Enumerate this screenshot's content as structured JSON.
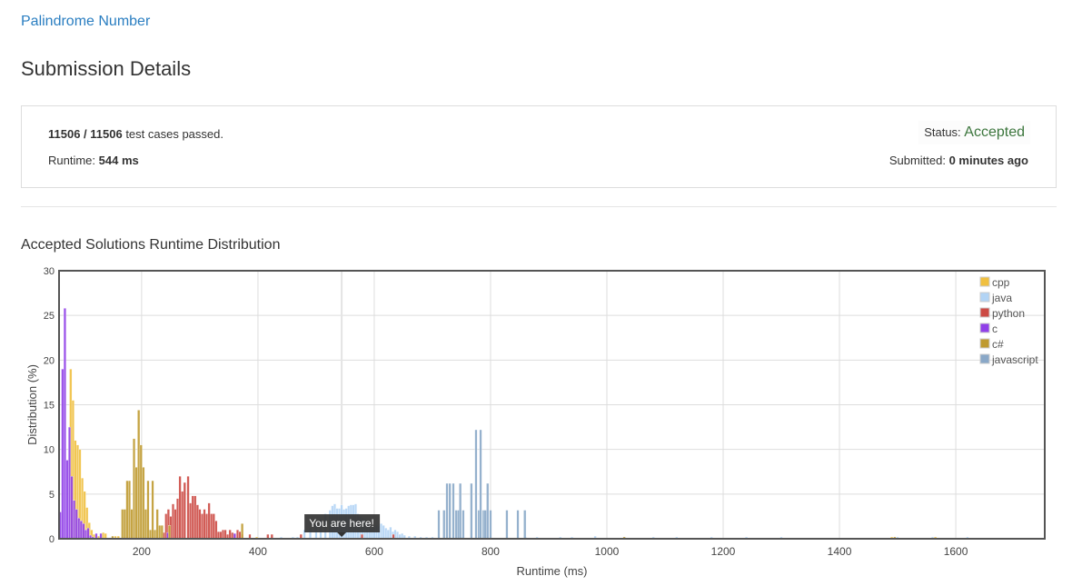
{
  "header": {
    "problem_link": "Palindrome Number",
    "page_title": "Submission Details"
  },
  "result": {
    "passed": "11506 / 11506",
    "passed_suffix": " test cases passed.",
    "runtime_label": "Runtime: ",
    "runtime_value": "544 ms",
    "status_label": "Status: ",
    "status_value": "Accepted",
    "submitted_label": "Submitted: ",
    "submitted_value": "0 minutes ago"
  },
  "chart_title": "Accepted Solutions Runtime Distribution",
  "chart_data": {
    "type": "bar",
    "xlabel": "Runtime (ms)",
    "ylabel": "Distribution (%)",
    "xlim": [
      58,
      1753
    ],
    "ylim": [
      0,
      30
    ],
    "xticks": [
      200,
      400,
      600,
      800,
      1000,
      1200,
      1400,
      1600
    ],
    "yticks": [
      0,
      5,
      10,
      15,
      20,
      25,
      30
    ],
    "grid": true,
    "legend_position": "top-right",
    "annotation": {
      "text": "You are here!",
      "x": 544
    },
    "series": [
      {
        "name": "cpp",
        "color": "#f0c040",
        "points": [
          [
            78,
            19
          ],
          [
            82,
            15.5
          ],
          [
            86,
            11
          ],
          [
            90,
            10.5
          ],
          [
            94,
            10
          ],
          [
            98,
            6.8
          ],
          [
            102,
            5.3
          ],
          [
            106,
            3.5
          ],
          [
            110,
            1.8
          ],
          [
            114,
            1
          ],
          [
            118,
            0.5
          ],
          [
            126,
            0.3
          ],
          [
            134,
            0.7
          ],
          [
            138,
            0.6
          ],
          [
            155,
            0.3
          ],
          [
            160,
            0.3
          ],
          [
            398,
            0.2
          ],
          [
            1030,
            0.2
          ],
          [
            1490,
            0.2
          ],
          [
            1565,
            0.2
          ]
        ]
      },
      {
        "name": "java",
        "color": "#b2d4f5",
        "points": [
          [
            440,
            0.2
          ],
          [
            460,
            0.2
          ],
          [
            468,
            0.2
          ],
          [
            480,
            1
          ],
          [
            490,
            1.2
          ],
          [
            500,
            1.8
          ],
          [
            508,
            2.2
          ],
          [
            516,
            2.8
          ],
          [
            524,
            3.2
          ],
          [
            528,
            3.7
          ],
          [
            532,
            3.9
          ],
          [
            536,
            3.4
          ],
          [
            540,
            3.4
          ],
          [
            544,
            3.8
          ],
          [
            548,
            3.3
          ],
          [
            552,
            3.4
          ],
          [
            556,
            3.7
          ],
          [
            560,
            3.8
          ],
          [
            564,
            3.8
          ],
          [
            568,
            3.9
          ],
          [
            572,
            2.8
          ],
          [
            576,
            2.5
          ],
          [
            580,
            2.3
          ],
          [
            584,
            2.2
          ],
          [
            588,
            2
          ],
          [
            592,
            1.8
          ],
          [
            596,
            1.2
          ],
          [
            600,
            1.3
          ],
          [
            604,
            1.5
          ],
          [
            608,
            1.4
          ],
          [
            612,
            1.7
          ],
          [
            616,
            1.5
          ],
          [
            620,
            1.2
          ],
          [
            624,
            1
          ],
          [
            628,
            1.3
          ],
          [
            632,
            0.8
          ],
          [
            636,
            1
          ],
          [
            640,
            0.8
          ],
          [
            644,
            0.5
          ],
          [
            648,
            0.6
          ],
          [
            652,
            0.4
          ],
          [
            660,
            0.3
          ],
          [
            670,
            0.3
          ],
          [
            680,
            0.2
          ],
          [
            690,
            0.2
          ],
          [
            700,
            0.2
          ],
          [
            750,
            0.2
          ],
          [
            860,
            0.2
          ],
          [
            880,
            0.2
          ],
          [
            920,
            0.2
          ],
          [
            940,
            0.2
          ],
          [
            980,
            0.3
          ],
          [
            1030,
            0.2
          ],
          [
            1080,
            0.2
          ],
          [
            1120,
            0.2
          ],
          [
            1180,
            0.2
          ],
          [
            1240,
            0.2
          ],
          [
            1300,
            0.2
          ],
          [
            1500,
            0.2
          ],
          [
            1560,
            0.2
          ],
          [
            1620,
            0.2
          ]
        ]
      },
      {
        "name": "python",
        "color": "#cc4a44",
        "points": [
          [
            238,
            0.7
          ],
          [
            242,
            2.8
          ],
          [
            246,
            3.3
          ],
          [
            250,
            2.5
          ],
          [
            254,
            3.9
          ],
          [
            258,
            3.3
          ],
          [
            262,
            4.5
          ],
          [
            266,
            7
          ],
          [
            270,
            5.3
          ],
          [
            274,
            6.3
          ],
          [
            280,
            7
          ],
          [
            284,
            4
          ],
          [
            288,
            4.8
          ],
          [
            292,
            4.8
          ],
          [
            296,
            3.8
          ],
          [
            300,
            3.3
          ],
          [
            304,
            2.8
          ],
          [
            308,
            3.3
          ],
          [
            312,
            2.8
          ],
          [
            316,
            4
          ],
          [
            320,
            2.8
          ],
          [
            324,
            2.8
          ],
          [
            328,
            2
          ],
          [
            332,
            0.8
          ],
          [
            336,
            0.8
          ],
          [
            340,
            1
          ],
          [
            344,
            1
          ],
          [
            348,
            0.5
          ],
          [
            352,
            1
          ],
          [
            356,
            0.7
          ],
          [
            360,
            0.5
          ],
          [
            365,
            1
          ],
          [
            369,
            0.8
          ],
          [
            373,
            0.5
          ],
          [
            386,
            0.5
          ],
          [
            417,
            0.5
          ],
          [
            424,
            0.5
          ],
          [
            474,
            0.5
          ],
          [
            579,
            0.5
          ],
          [
            633,
            0.5
          ]
        ]
      },
      {
        "name": "c",
        "color": "#9040e8",
        "points": [
          [
            60,
            3
          ],
          [
            64,
            19
          ],
          [
            68,
            25.8
          ],
          [
            72,
            8.8
          ],
          [
            76,
            12.5
          ],
          [
            80,
            7
          ],
          [
            84,
            4.3
          ],
          [
            88,
            3.3
          ],
          [
            92,
            2.3
          ],
          [
            96,
            2
          ],
          [
            100,
            1.7
          ],
          [
            104,
            1
          ],
          [
            108,
            1.2
          ],
          [
            112,
            0.4
          ],
          [
            116,
            0.2
          ],
          [
            122,
            0.6
          ],
          [
            130,
            0.6
          ],
          [
            245,
            0.7
          ],
          [
            360,
            0.6
          ]
        ]
      },
      {
        "name": "c#",
        "color": "#bf9a30",
        "points": [
          [
            150,
            0.3
          ],
          [
            167,
            3.3
          ],
          [
            171,
            3.3
          ],
          [
            175,
            6.5
          ],
          [
            179,
            6.5
          ],
          [
            183,
            3.3
          ],
          [
            187,
            11.2
          ],
          [
            191,
            8
          ],
          [
            195,
            14.4
          ],
          [
            199,
            10.5
          ],
          [
            203,
            8
          ],
          [
            207,
            3.3
          ],
          [
            211,
            6.5
          ],
          [
            215,
            1
          ],
          [
            219,
            6.5
          ],
          [
            223,
            1
          ],
          [
            227,
            3.3
          ],
          [
            231,
            1.5
          ],
          [
            235,
            1.5
          ],
          [
            248,
            1.5
          ],
          [
            373,
            1.7
          ],
          [
            1030,
            0.2
          ],
          [
            1495,
            0.2
          ]
        ]
      },
      {
        "name": "javascript",
        "color": "#8aa8c8",
        "points": [
          [
            711,
            3.2
          ],
          [
            720,
            3.2
          ],
          [
            725,
            6.2
          ],
          [
            730,
            6.2
          ],
          [
            736,
            6.2
          ],
          [
            741,
            3.2
          ],
          [
            745,
            3.2
          ],
          [
            748,
            6.2
          ],
          [
            753,
            3.2
          ],
          [
            767,
            6.2
          ],
          [
            775,
            12.2
          ],
          [
            780,
            3.2
          ],
          [
            783,
            12.2
          ],
          [
            788,
            3.2
          ],
          [
            791,
            3.2
          ],
          [
            795,
            6.2
          ],
          [
            800,
            3.2
          ],
          [
            828,
            3.2
          ],
          [
            847,
            3.2
          ],
          [
            859,
            3.2
          ]
        ]
      }
    ]
  }
}
